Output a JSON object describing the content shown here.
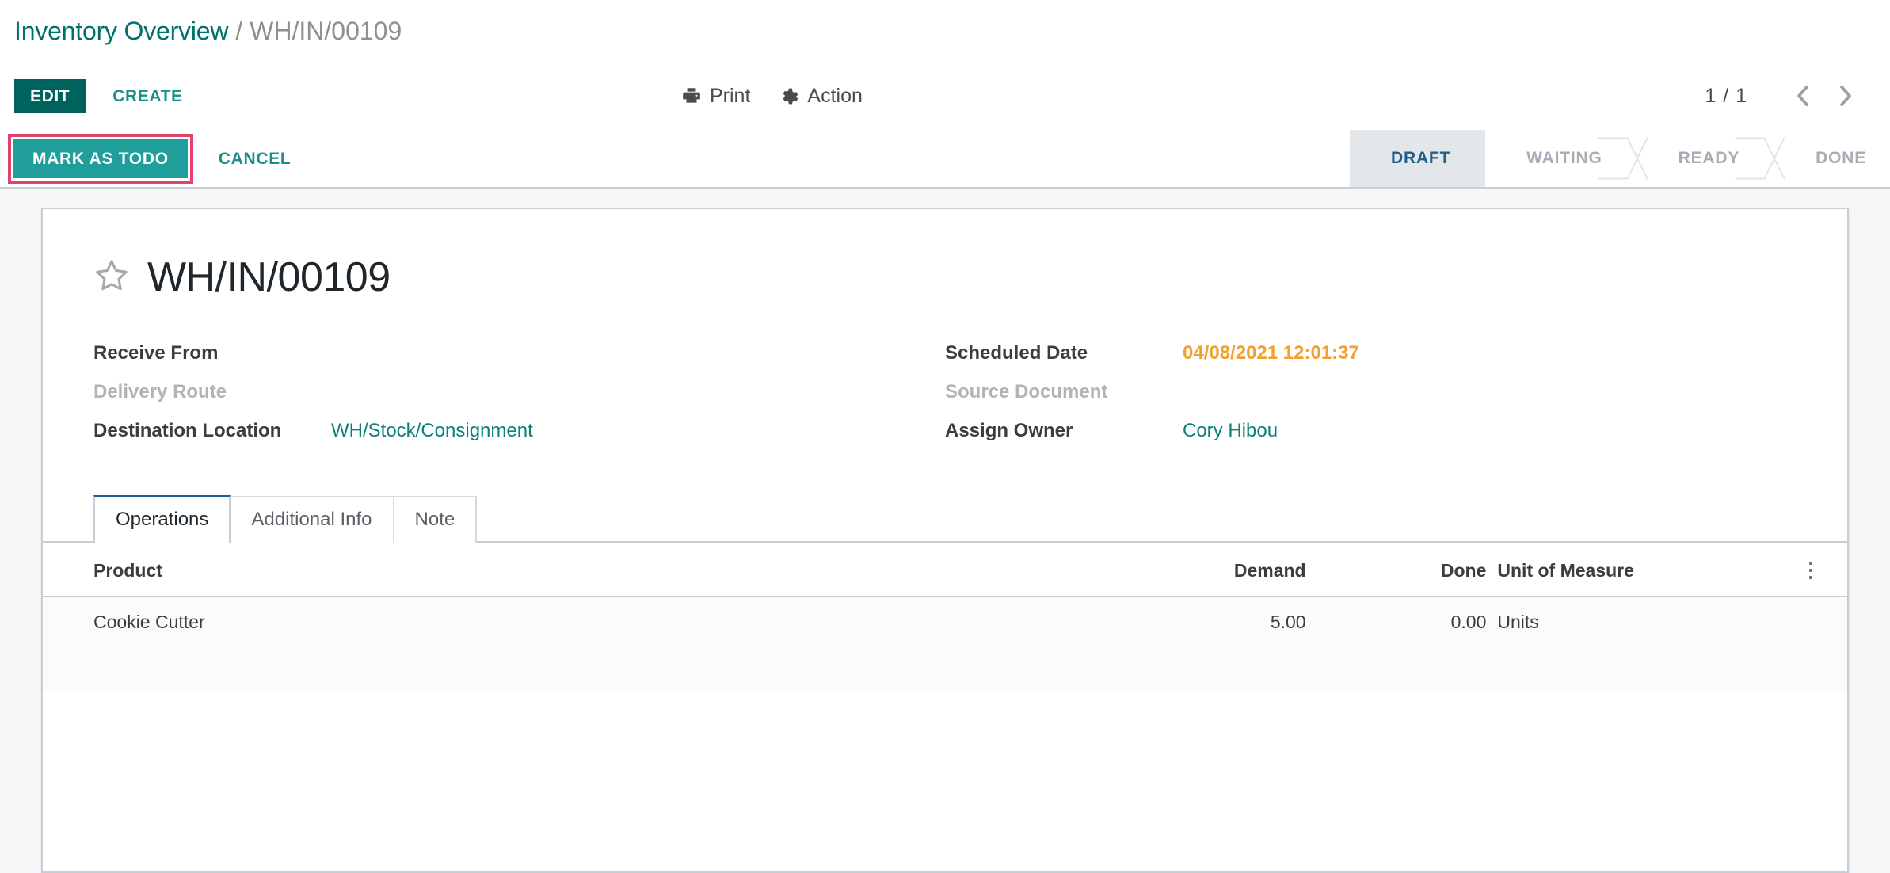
{
  "breadcrumb": {
    "root": "Inventory Overview",
    "separator": "/",
    "current": "WH/IN/00109"
  },
  "control_panel": {
    "edit_label": "EDIT",
    "create_label": "CREATE",
    "print_label": "Print",
    "action_label": "Action",
    "print_icon": "printer-icon",
    "action_icon": "gear-icon",
    "pager": {
      "count": "1 / 1",
      "previous_icon": "chevron-left-icon",
      "next_icon": "chevron-right-icon"
    }
  },
  "statusbar": {
    "mark_as_todo_label": "MARK AS TODO",
    "cancel_label": "CANCEL",
    "highlight_color": "#e04269",
    "todo_button_color": "#1f9e9b",
    "stages": [
      {
        "label": "DRAFT",
        "active": true
      },
      {
        "label": "WAITING",
        "active": false
      },
      {
        "label": "READY",
        "active": false
      },
      {
        "label": "DONE",
        "active": false
      }
    ]
  },
  "record": {
    "favorite_icon": "star-outline-icon",
    "title": "WH/IN/00109",
    "fields_left": [
      {
        "label": "Receive From",
        "value": "",
        "style": "plain"
      },
      {
        "label": "Delivery Route",
        "value": "",
        "style": "muted"
      },
      {
        "label": "Destination Location",
        "value": "WH/Stock/Consignment",
        "style": "link"
      }
    ],
    "fields_right": [
      {
        "label": "Scheduled Date",
        "value": "04/08/2021 12:01:37",
        "style": "date"
      },
      {
        "label": "Source Document",
        "value": "",
        "style": "muted"
      },
      {
        "label": "Assign Owner",
        "value": "Cory Hibou",
        "style": "link"
      }
    ]
  },
  "notebook": {
    "tabs": [
      {
        "label": "Operations",
        "active": true
      },
      {
        "label": "Additional Info",
        "active": false
      },
      {
        "label": "Note",
        "active": false
      }
    ]
  },
  "operations_table": {
    "columns": {
      "product": "Product",
      "demand": "Demand",
      "done": "Done",
      "uom": "Unit of Measure",
      "options_icon": "vertical-ellipsis-icon"
    },
    "rows": [
      {
        "product": "Cookie Cutter",
        "demand": "5.00",
        "done": "0.00",
        "uom": "Units"
      }
    ]
  },
  "colors": {
    "brand_teal": "#00706b",
    "button_teal_dark": "#00625c",
    "button_teal": "#1f9e9b",
    "link_teal": "#0d8176",
    "date_orange": "#f0a12e",
    "active_stage_blue": "#1f5f8b",
    "highlight_pink": "#e04269",
    "page_background": "#f7f7f7"
  }
}
